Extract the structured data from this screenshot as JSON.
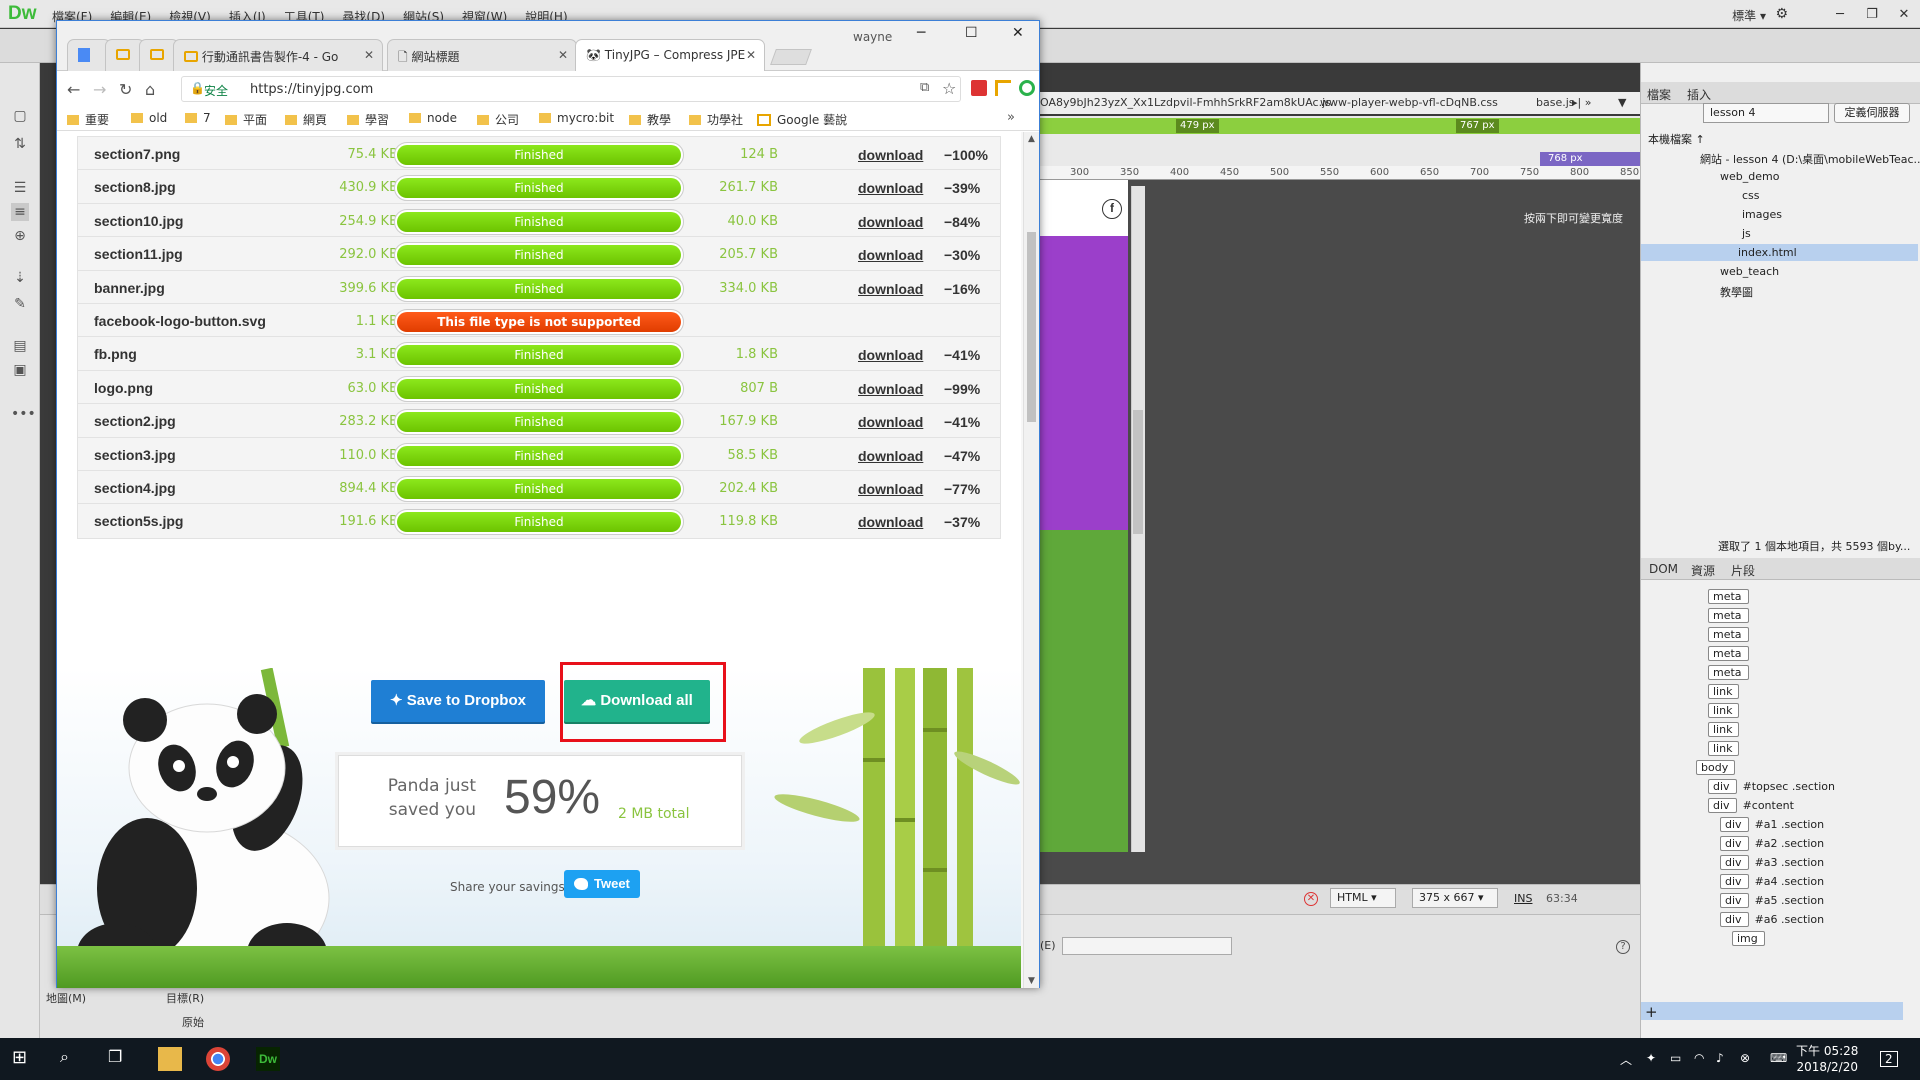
{
  "dreamweaver": {
    "logo": "Dw",
    "menus": [
      "檔案(F)",
      "編輯(E)",
      "檢視(V)",
      "插入(I)",
      "工具(T)",
      "尋找(D)",
      "網站(S)",
      "視窗(W)",
      "說明(H)"
    ],
    "workspace": "標準",
    "file_tabs": [
      "OA8y9bJh23yzX_Xx1Lzdpvil-FmhhSrkRF2am8kUAc.js",
      "www-player-webp-vfl-cDqNB.css",
      "base.js"
    ],
    "breakpoints": [
      "479 px",
      "767 px",
      "768 px"
    ],
    "ruler_ticks": [
      "300",
      "350",
      "400",
      "450",
      "500",
      "550",
      "600",
      "650",
      "700",
      "750",
      "800",
      "850"
    ],
    "design_hint": "按兩下即可變更寬度",
    "status": {
      "doc_type": "HTML",
      "size": "375 x 667",
      "mode": "INS",
      "position": "63:34"
    },
    "properties": {
      "map_label": "地圖(M)",
      "target_label": "目標(R)",
      "origin_label": "原始",
      "edit_label": "(E)"
    },
    "files_panel": {
      "tabs": [
        "檔案",
        "插入"
      ],
      "site": "lesson 4",
      "define_server": "定義伺服器",
      "local_files": "本機檔案 ↑",
      "tree": [
        {
          "label": "網站 - lesson 4 (D:\\桌面\\mobileWebTeac...",
          "level": 0
        },
        {
          "label": "web_demo",
          "level": 1
        },
        {
          "label": "css",
          "level": 2
        },
        {
          "label": "images",
          "level": 2
        },
        {
          "label": "js",
          "level": 2
        },
        {
          "label": "index.html",
          "level": 2,
          "selected": true
        },
        {
          "label": "web_teach",
          "level": 1
        },
        {
          "label": "教學圖",
          "level": 1
        }
      ],
      "status": "選取了 1 個本地項目，共 5593 個by..."
    },
    "dom_panel": {
      "tabs": [
        "DOM",
        "資源",
        "片段"
      ],
      "nodes": [
        {
          "tag": "meta",
          "id": "",
          "level": 3
        },
        {
          "tag": "meta",
          "id": "",
          "level": 3
        },
        {
          "tag": "meta",
          "id": "",
          "level": 3
        },
        {
          "tag": "meta",
          "id": "",
          "level": 3
        },
        {
          "tag": "meta",
          "id": "",
          "level": 3
        },
        {
          "tag": "link",
          "id": "",
          "level": 3
        },
        {
          "tag": "link",
          "id": "",
          "level": 3
        },
        {
          "tag": "link",
          "id": "",
          "level": 3
        },
        {
          "tag": "link",
          "id": "",
          "level": 3
        },
        {
          "tag": "body",
          "id": "",
          "level": 2
        },
        {
          "tag": "div",
          "id": "#topsec .section",
          "level": 3
        },
        {
          "tag": "div",
          "id": "#content",
          "level": 3
        },
        {
          "tag": "div",
          "id": "#a1 .section",
          "level": 4
        },
        {
          "tag": "div",
          "id": "#a2 .section",
          "level": 4
        },
        {
          "tag": "div",
          "id": "#a3 .section",
          "level": 4
        },
        {
          "tag": "div",
          "id": "#a4 .section",
          "level": 4
        },
        {
          "tag": "div",
          "id": "#a5 .section",
          "level": 4
        },
        {
          "tag": "div",
          "id": "#a6 .section",
          "level": 4
        },
        {
          "tag": "img",
          "id": "",
          "level": 5
        }
      ]
    }
  },
  "chrome": {
    "user": "wayne",
    "tabs": [
      {
        "title": "",
        "icon": "google-icon"
      },
      {
        "title": "",
        "icon": "folder-icon"
      },
      {
        "title": "",
        "icon": "folder-icon"
      },
      {
        "title": "行動通訊書告製作-4 - Go",
        "icon": "folder-icon"
      },
      {
        "title": "網站標題",
        "icon": "page-icon"
      },
      {
        "title": "TinyJPG – Compress JPE",
        "icon": "panda-icon",
        "active": true
      }
    ],
    "secure_label": "安全",
    "url": "https://tinyjpg.com",
    "bookmarks": [
      "重要",
      "old",
      "7",
      "平面",
      "網頁",
      "學習",
      "node",
      "公司",
      "mycro:bit",
      "教學",
      "功學社"
    ],
    "google_bookmark": "Google 藝說"
  },
  "results": [
    {
      "name": "section7.png",
      "original": "75.4 KB",
      "status": "Finished",
      "compressed": "124 B",
      "link": "download",
      "saving": "−100%"
    },
    {
      "name": "section8.jpg",
      "original": "430.9 KB",
      "status": "Finished",
      "compressed": "261.7 KB",
      "link": "download",
      "saving": "−39%"
    },
    {
      "name": "section10.jpg",
      "original": "254.9 KB",
      "status": "Finished",
      "compressed": "40.0 KB",
      "link": "download",
      "saving": "−84%"
    },
    {
      "name": "section11.jpg",
      "original": "292.0 KB",
      "status": "Finished",
      "compressed": "205.7 KB",
      "link": "download",
      "saving": "−30%"
    },
    {
      "name": "banner.jpg",
      "original": "399.6 KB",
      "status": "Finished",
      "compressed": "334.0 KB",
      "link": "download",
      "saving": "−16%"
    },
    {
      "name": "facebook-logo-button.svg",
      "original": "1.1 KB",
      "status": "This file type is not supported",
      "error": true,
      "compressed": "",
      "link": "",
      "saving": ""
    },
    {
      "name": "fb.png",
      "original": "3.1 KB",
      "status": "Finished",
      "compressed": "1.8 KB",
      "link": "download",
      "saving": "−41%"
    },
    {
      "name": "logo.png",
      "original": "63.0 KB",
      "status": "Finished",
      "compressed": "807 B",
      "link": "download",
      "saving": "−99%"
    },
    {
      "name": "section2.jpg",
      "original": "283.2 KB",
      "status": "Finished",
      "compressed": "167.9 KB",
      "link": "download",
      "saving": "−41%"
    },
    {
      "name": "section3.jpg",
      "original": "110.0 KB",
      "status": "Finished",
      "compressed": "58.5 KB",
      "link": "download",
      "saving": "−47%"
    },
    {
      "name": "section4.jpg",
      "original": "894.4 KB",
      "status": "Finished",
      "compressed": "202.4 KB",
      "link": "download",
      "saving": "−77%"
    },
    {
      "name": "section5s.jpg",
      "original": "191.6 KB",
      "status": "Finished",
      "compressed": "119.8 KB",
      "link": "download",
      "saving": "−37%"
    }
  ],
  "panda": {
    "dropbox_label": "Save to Dropbox",
    "download_all_label": "Download all",
    "saved_text": "Panda just saved you",
    "saved_pct": "59%",
    "saved_total": "2 MB total",
    "share_text": "Share your savings",
    "tweet_label": "Tweet"
  },
  "taskbar": {
    "time": "下午 05:28",
    "date": "2018/2/20",
    "notifications": "2"
  },
  "colors": {
    "progress_green": "#7fd600",
    "error_orange": "#ff4e0a",
    "dropbox_blue": "#1f7fd4",
    "download_teal": "#21b38c",
    "highlight_red": "#e8101a",
    "tweet_blue": "#1da1f2"
  }
}
